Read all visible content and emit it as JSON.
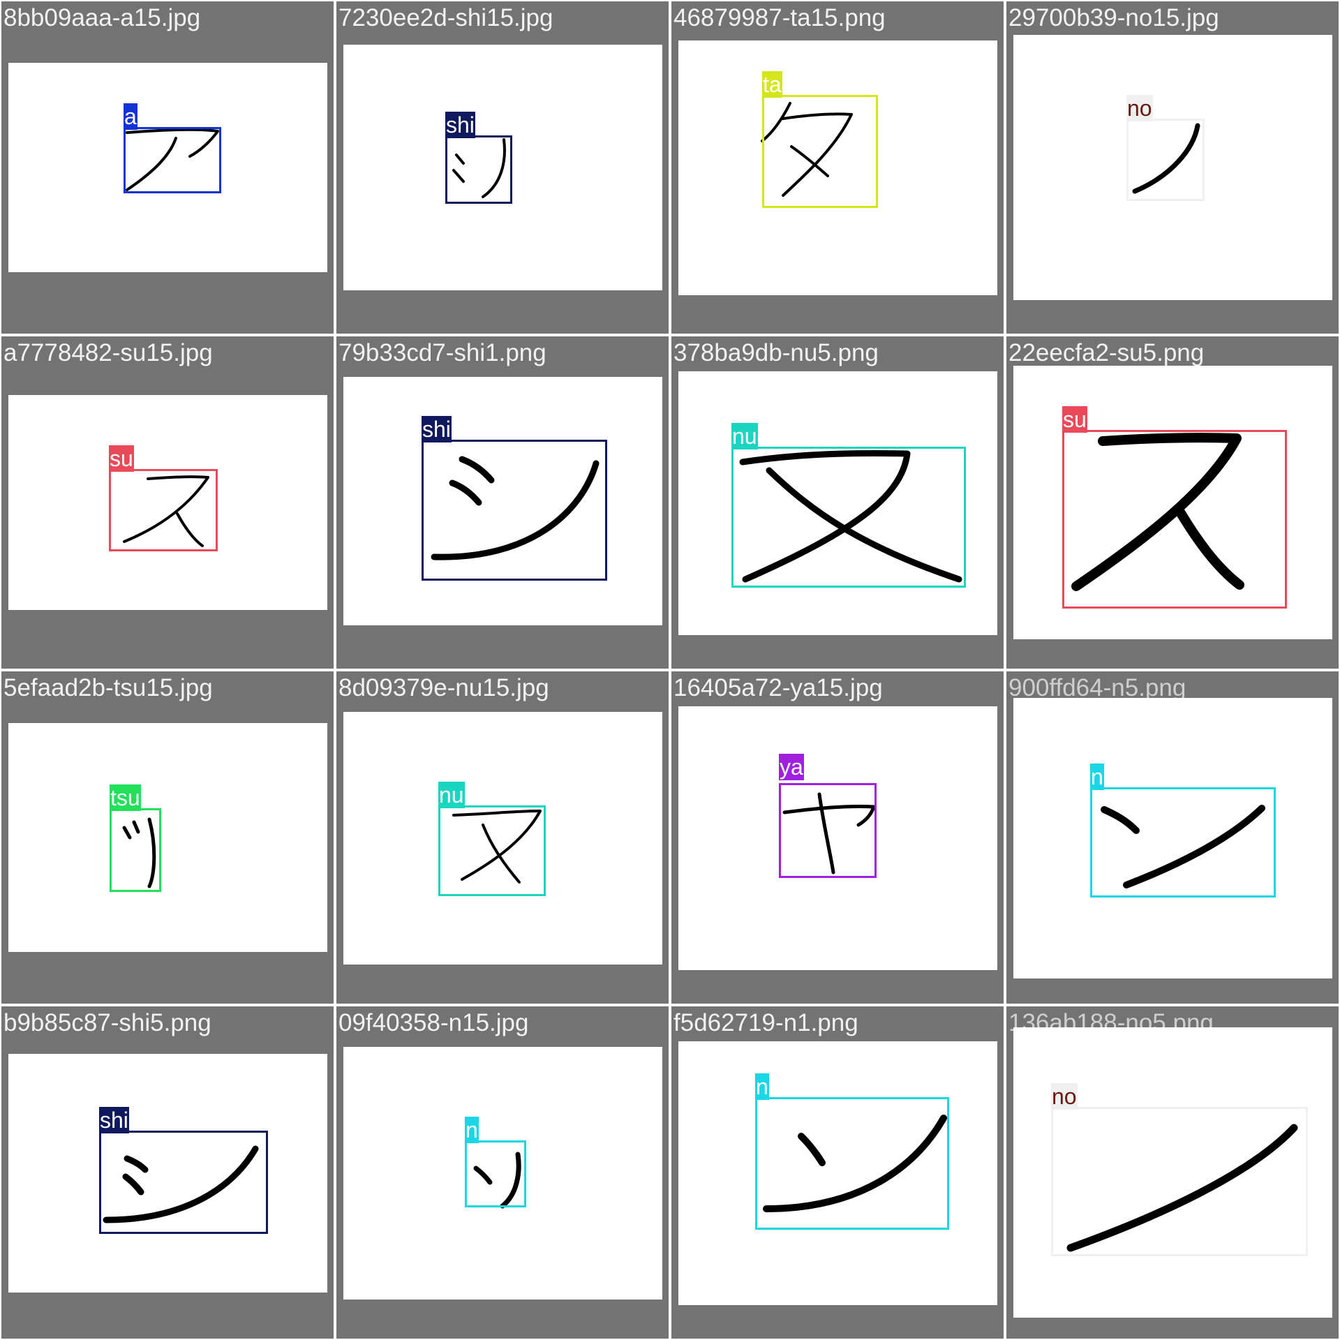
{
  "tiles": [
    {
      "file": "8bb09aaa-a15.jpg",
      "label": "a",
      "color": "#1433d6"
    },
    {
      "file": "7230ee2d-shi15.jpg",
      "label": "shi",
      "color": "#0f1a5e"
    },
    {
      "file": "46879987-ta15.png",
      "label": "ta",
      "color": "#d4e61a"
    },
    {
      "file": "29700b39-no15.jpg",
      "label": "no",
      "color": "#f0f0f0"
    },
    {
      "file": "a7778482-su15.jpg",
      "label": "su",
      "color": "#e84a5a"
    },
    {
      "file": "79b33cd7-shi1.png",
      "label": "shi",
      "color": "#0f1a5e"
    },
    {
      "file": "378ba9db-nu5.png",
      "label": "nu",
      "color": "#1ad6c0"
    },
    {
      "file": "22eecfa2-su5.png",
      "label": "su",
      "color": "#e84a5a"
    },
    {
      "file": "5efaad2b-tsu15.jpg",
      "label": "tsu",
      "color": "#22e05a"
    },
    {
      "file": "8d09379e-nu15.jpg",
      "label": "nu",
      "color": "#1ad6c0"
    },
    {
      "file": "16405a72-ya15.jpg",
      "label": "ya",
      "color": "#a020e0"
    },
    {
      "file": "900ffd64-n5.png",
      "label": "n",
      "color": "#1ad6e6"
    },
    {
      "file": "b9b85c87-shi5.png",
      "label": "shi",
      "color": "#0f1a5e"
    },
    {
      "file": "09f40358-n15.jpg",
      "label": "n",
      "color": "#1ad6e6"
    },
    {
      "file": "f5d62719-n1.png",
      "label": "n",
      "color": "#1ad6e6"
    },
    {
      "file": "136ab188-no5.png",
      "label": "no",
      "color": "#f0f0f0"
    }
  ]
}
